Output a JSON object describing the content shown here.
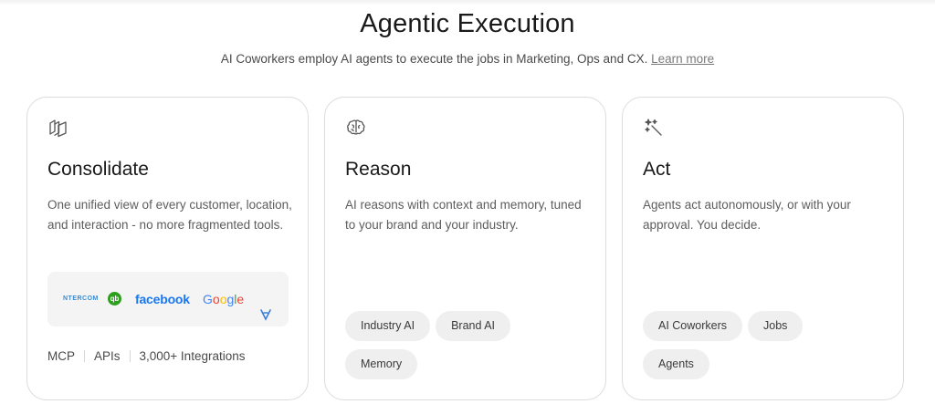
{
  "header": {
    "title": "Agentic Execution",
    "subtitle": "AI Coworkers employ AI agents to execute the jobs in Marketing, Ops and CX.",
    "learn_more": "Learn more"
  },
  "cards": [
    {
      "icon": "layers-icon",
      "title": "Consolidate",
      "description": "One unified view of every customer, location, and interaction - no more fragmented tools.",
      "logos": {
        "intercom": "NTERCOM",
        "quickbooks": "qb",
        "facebook": "facebook",
        "google": [
          "G",
          "o",
          "o",
          "g",
          "l",
          "e"
        ]
      },
      "meta": [
        "MCP",
        "APIs",
        "3,000+ Integrations"
      ]
    },
    {
      "icon": "brain-icon",
      "title": "Reason",
      "description": "AI reasons with context and memory, tuned to your brand and your industry.",
      "chips": [
        "Industry AI",
        "Brand AI",
        "Memory"
      ]
    },
    {
      "icon": "magic-wand-icon",
      "title": "Act",
      "description": "Agents act autonomously, or with your approval. You decide.",
      "chips": [
        "AI Coworkers",
        "Jobs",
        "Agents"
      ]
    }
  ],
  "colors": {
    "facebook": "#1877f2",
    "quickbooks": "#2ca01c",
    "intercom": "#3b8bd0",
    "chip_bg": "#efefef",
    "card_border": "#dcdcdc"
  }
}
